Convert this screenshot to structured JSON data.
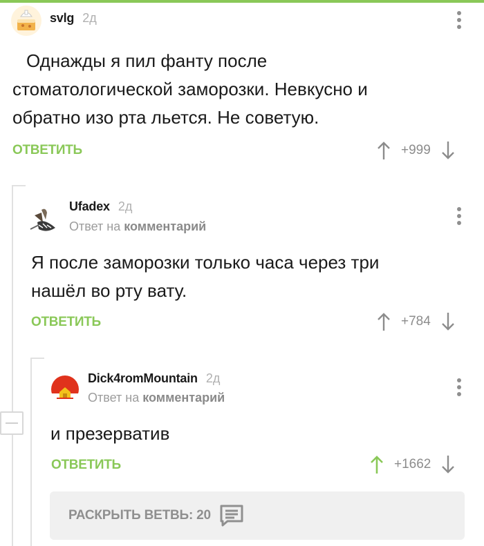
{
  "comments": [
    {
      "username": "svlg",
      "time": "2д",
      "text_lines": [
        "Однажды  я пил фанту после",
        "стоматологической заморозки.    Невкусно и",
        "обратно изо рта  льется.   Не советую."
      ],
      "reply_label": "ОТВЕТИТЬ",
      "rating": "+999",
      "avatar": "cake-avatar"
    },
    {
      "username": "Ufadex",
      "time": "2д",
      "reply_prefix": "Ответ на",
      "reply_target": "комментарий",
      "text_lines": [
        "Я после заморозки только часа через три",
        "нашёл во рту вату."
      ],
      "reply_label": "ОТВЕТИТЬ",
      "rating": "+784",
      "avatar": "bird-avatar"
    },
    {
      "username": "Dick4romMountain",
      "time": "2д",
      "reply_prefix": "Ответ на",
      "reply_target": "комментарий",
      "text_lines": [
        "и презерватив"
      ],
      "reply_label": "ОТВЕТИТЬ",
      "rating": "+1662",
      "avatar": "sunset-house-avatar",
      "upvoted": true
    }
  ],
  "expand_thread": {
    "label": "РАСКРЫТЬ ВЕТВЬ: 20",
    "icon": "comments-icon"
  },
  "colors": {
    "accent": "#8ac858",
    "muted": "#8c8c8c"
  }
}
